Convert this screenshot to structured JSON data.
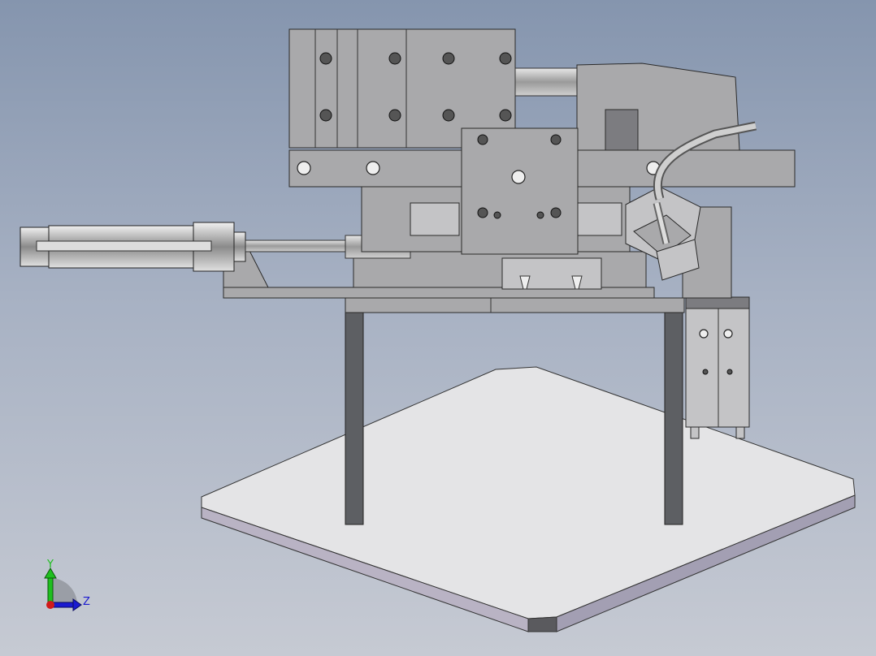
{
  "viewport": {
    "title": "3D model view",
    "background_top": "#8595ae",
    "background_bottom": "#c6cad3"
  },
  "triad": {
    "y_label": "Y",
    "z_label": "Z",
    "y_color": "#1fbf1f",
    "z_color": "#1a1ad0",
    "x_color": "#d01a1a"
  }
}
